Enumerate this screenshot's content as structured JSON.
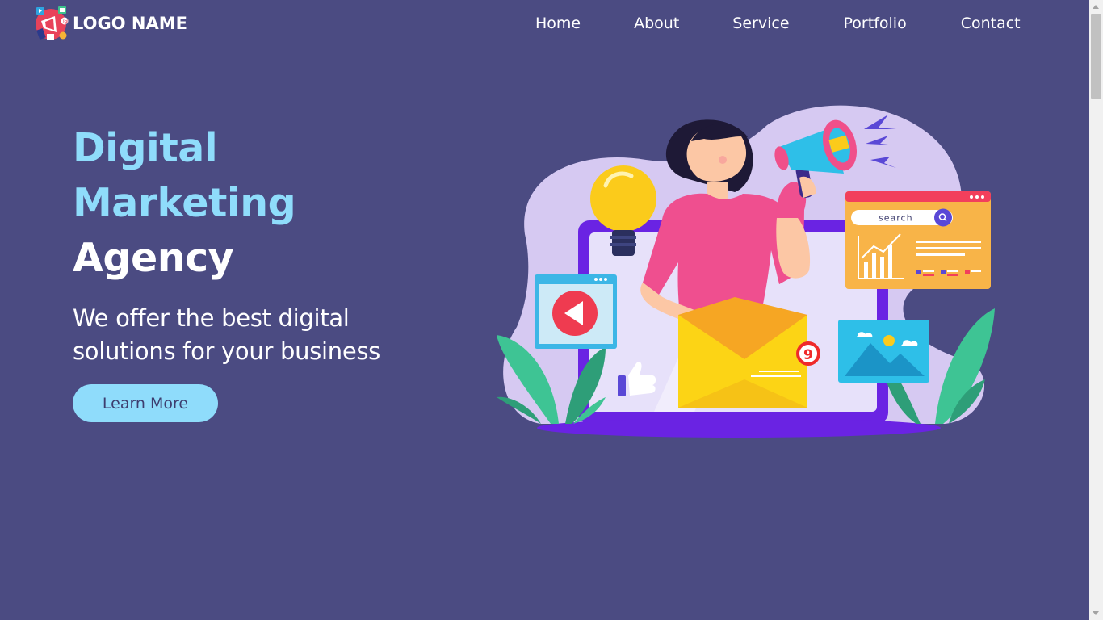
{
  "header": {
    "logo_text": "LOGO NAME",
    "nav": [
      "Home",
      "About",
      "Service",
      "Portfolio",
      "Contact"
    ]
  },
  "hero": {
    "title_line1": "Digital",
    "title_line2": "Marketing",
    "title_line3": "Agency",
    "subtitle_line1": "We offer the best digital",
    "subtitle_line2": "solutions for your business",
    "cta_label": "Learn More"
  },
  "illustration": {
    "search_placeholder": "search",
    "notification_count": "9"
  },
  "colors": {
    "background": "#4b4b82",
    "accent": "#8fdcfb",
    "text": "#ffffff",
    "cta_text": "#3d3d6e"
  },
  "icons": [
    "logo-icon",
    "megaphone-icon",
    "lightbulb-icon",
    "play-icon",
    "like-icon",
    "image-icon",
    "search-icon",
    "bar-chart-icon",
    "envelope-icon"
  ]
}
